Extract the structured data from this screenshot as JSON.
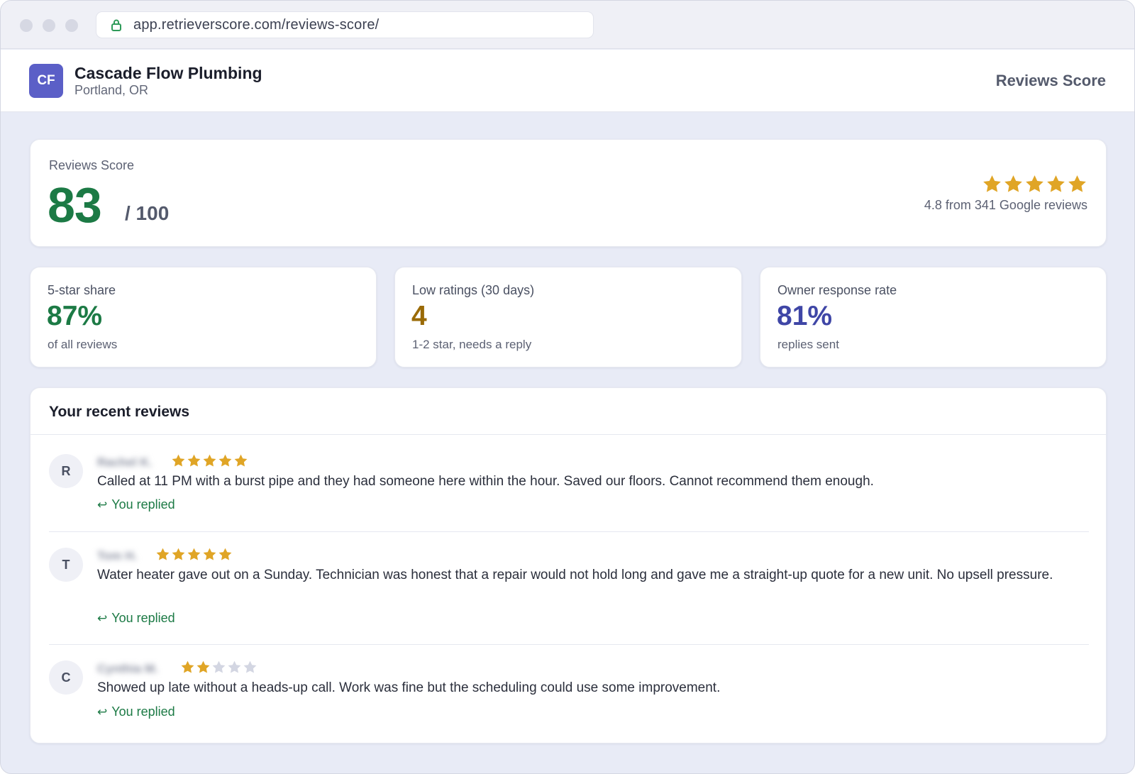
{
  "browser": {
    "url": "app.retrieverscore.com/reviews-score/"
  },
  "header": {
    "business_initials": "CF",
    "business_name": "Cascade Flow Plumbing",
    "business_location": "Portland, OR",
    "page_title": "Reviews Score"
  },
  "score": {
    "label": "Reviews Score",
    "value": "83",
    "max": "/ 100",
    "star_rating": 5,
    "rating_text": "4.8 from 341 Google reviews"
  },
  "stats": [
    {
      "label": "5-star share",
      "value": "87%",
      "sub": "of all reviews",
      "color": "#1c7a45"
    },
    {
      "label": "Low ratings (30 days)",
      "value": "4",
      "sub": "1-2 star, needs a reply",
      "color": "#9a6a06"
    },
    {
      "label": "Owner response rate",
      "value": "81%",
      "sub": "replies sent",
      "color": "#3f46a6"
    }
  ],
  "reviews": {
    "title": "Your recent reviews",
    "items": [
      {
        "initial": "R",
        "name": "Rachel K.",
        "stars": 5,
        "text": "Called at 11 PM with a burst pipe and they had someone here within the hour. Saved our floors. Cannot recommend them enough.",
        "reply_status": "You replied"
      },
      {
        "initial": "T",
        "name": "Tom H.",
        "stars": 5,
        "text": "Water heater gave out on a Sunday. Technician was honest that a repair would not hold long and gave me a straight-up quote for a new unit. No upsell pressure.",
        "reply_status": "You replied"
      },
      {
        "initial": "C",
        "name": "Cynthia M.",
        "stars": 2,
        "text": "Showed up late without a heads-up call. Work was fine but the scheduling could use some improvement.",
        "reply_status": "You replied"
      }
    ]
  },
  "colors": {
    "star_filled": "#e0a526",
    "star_empty": "#d3d6e2",
    "brand": "#5b5fc7",
    "positive": "#1c7a45"
  },
  "icons": {
    "lock": "lock-icon",
    "star": "star-icon",
    "reply": "reply-arrow-icon"
  }
}
